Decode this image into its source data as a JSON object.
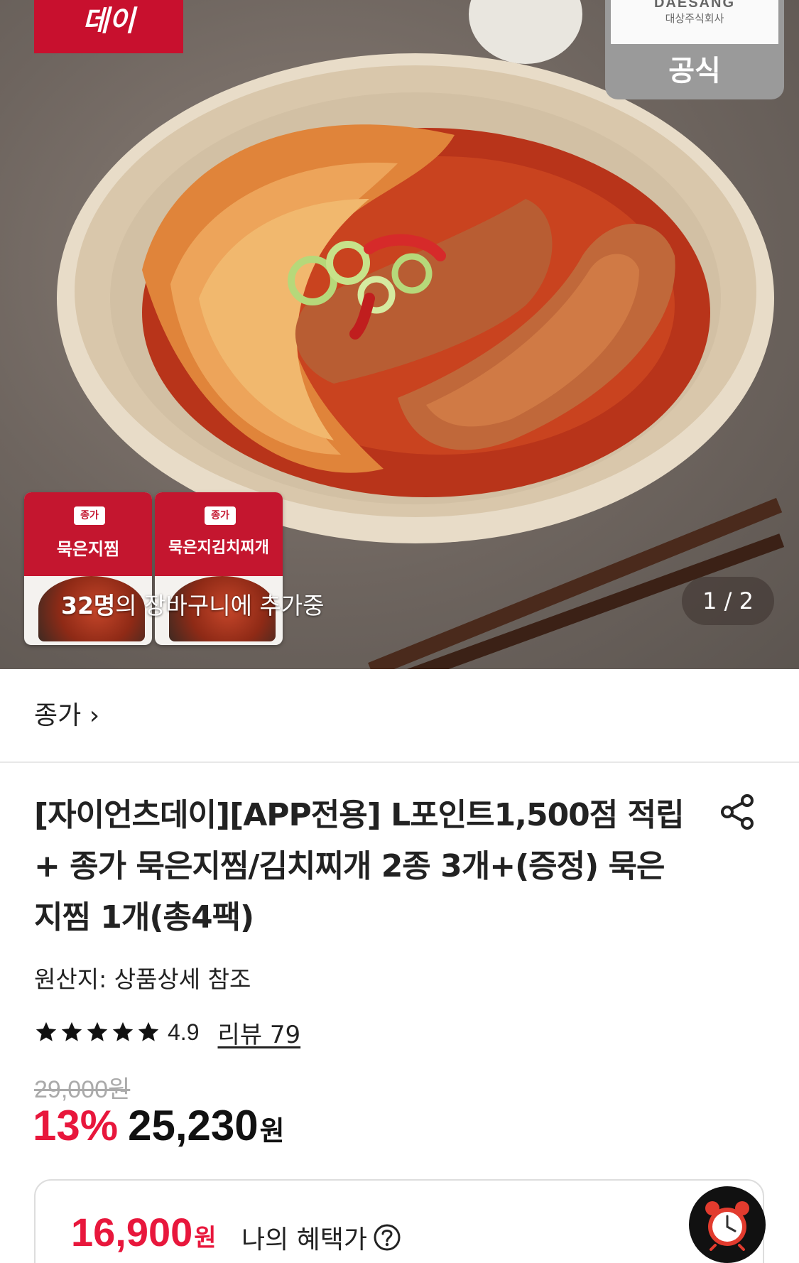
{
  "hero": {
    "logo_text": "데이",
    "badge": {
      "brand_en": "DAESANG",
      "brand_ko": "대상주식회사",
      "label": "공식"
    },
    "packs": [
      {
        "brand": "종가",
        "name": "묵은지찜"
      },
      {
        "brand": "종가",
        "name": "묵은지김치찌개"
      }
    ],
    "cart_info": {
      "count": "32명",
      "suffix": "의 장바구니에 추가중"
    },
    "page_indicator": "1 / 2"
  },
  "brand_link": {
    "label": "종가",
    "chevron": "›"
  },
  "product": {
    "title": "[자이언츠데이][APP전용] L포인트1,500점 적립 + 종가 묵은지찜/김치찌개 2종 3개+(증정) 묵은지찜 1개(총4팩)",
    "origin": "원산지: 상품상세 참조",
    "rating": {
      "stars": 5,
      "value": "4.9",
      "review_label": "리뷰 79"
    },
    "original_price": "29,000원",
    "discount": "13%",
    "sale_price": "25,230",
    "currency": "원"
  },
  "benefit": {
    "price": "16,900",
    "currency": "원",
    "label": "나의 혜택가"
  },
  "icons": {
    "share": "share-icon",
    "help": "question-circle-icon",
    "timer": "alarm-clock-icon",
    "star": "star-icon"
  },
  "colors": {
    "accent_red": "#e8173c",
    "logo_red": "#c8102e"
  }
}
